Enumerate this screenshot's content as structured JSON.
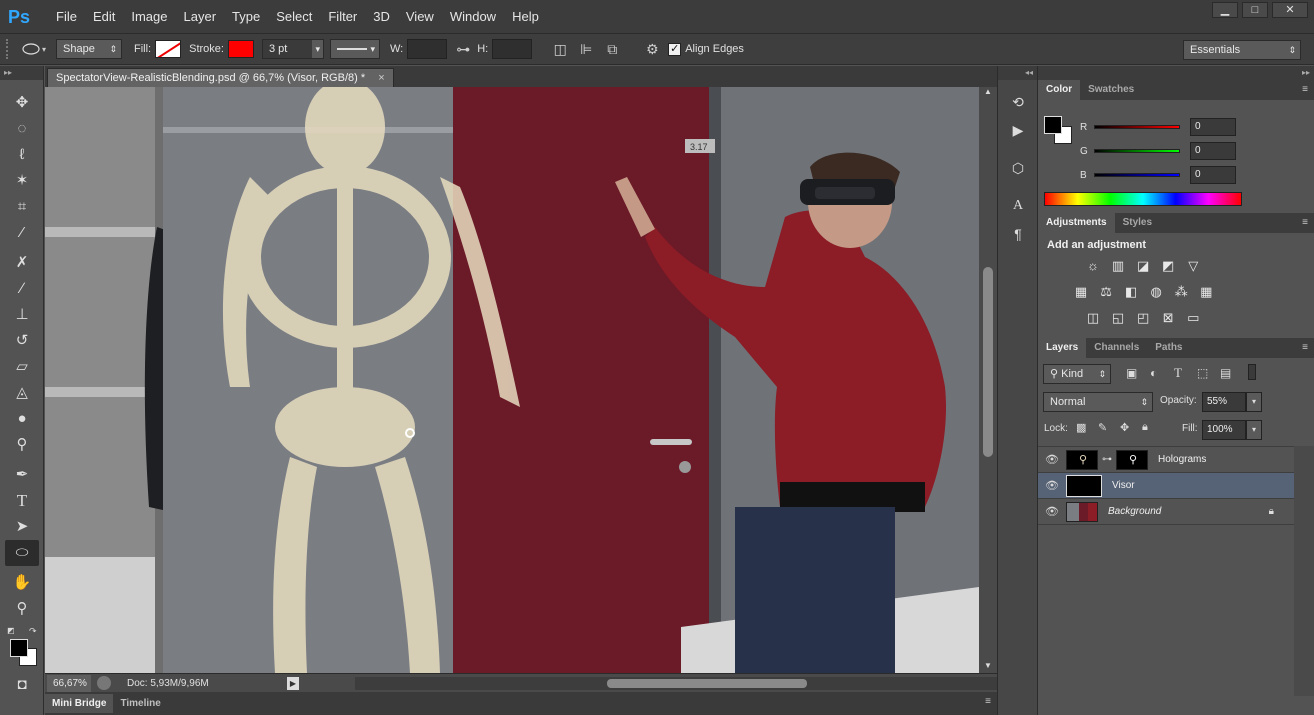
{
  "app": {
    "logo": "Ps"
  },
  "menu": [
    "File",
    "Edit",
    "Image",
    "Layer",
    "Type",
    "Select",
    "Filter",
    "3D",
    "View",
    "Window",
    "Help"
  ],
  "window_controls": {
    "minimize": "▁",
    "maximize": "□",
    "close": "✕"
  },
  "options_bar": {
    "tool_mode": "Shape",
    "fill_label": "Fill:",
    "stroke_label": "Stroke:",
    "stroke_width": "3 pt",
    "width_label": "W:",
    "height_label": "H:",
    "align_edges": "Align Edges",
    "align_edges_checked": true,
    "workspace": "Essentials",
    "stroke_color": "#ff0000"
  },
  "document": {
    "tab_title": "SpectatorView-RealisticBlending.psd @ 66,7% (Visor, RGB/8) *",
    "close_glyph": "×",
    "door_sign": "3.17"
  },
  "status": {
    "zoom": "66,67%",
    "doc_info": "Doc: 5,93M/9,96M"
  },
  "bottom_tabs": [
    "Mini Bridge",
    "Timeline"
  ],
  "color_panel": {
    "tabs": [
      "Color",
      "Swatches"
    ],
    "r_label": "R",
    "g_label": "G",
    "b_label": "B",
    "r": "0",
    "g": "0",
    "b": "0"
  },
  "adjustments_panel": {
    "tabs": [
      "Adjustments",
      "Styles"
    ],
    "heading": "Add an adjustment"
  },
  "layers_panel": {
    "tabs": [
      "Layers",
      "Channels",
      "Paths"
    ],
    "filter_kind": "Kind",
    "blend_mode": "Normal",
    "opacity_label": "Opacity:",
    "opacity": "55%",
    "lock_label": "Lock:",
    "fill_label": "Fill:",
    "fill": "100%",
    "layers": [
      {
        "name": "Holograms",
        "visible": true,
        "selected": false,
        "italic": false,
        "locked": false
      },
      {
        "name": "Visor",
        "visible": true,
        "selected": true,
        "italic": false,
        "locked": false
      },
      {
        "name": "Background",
        "visible": true,
        "selected": false,
        "italic": true,
        "locked": true
      }
    ]
  },
  "colors": {
    "selection_blue": "#566275",
    "ps_blue": "#31a8ff",
    "door_red": "#6b1a28",
    "sweater_red": "#8c1c26"
  }
}
